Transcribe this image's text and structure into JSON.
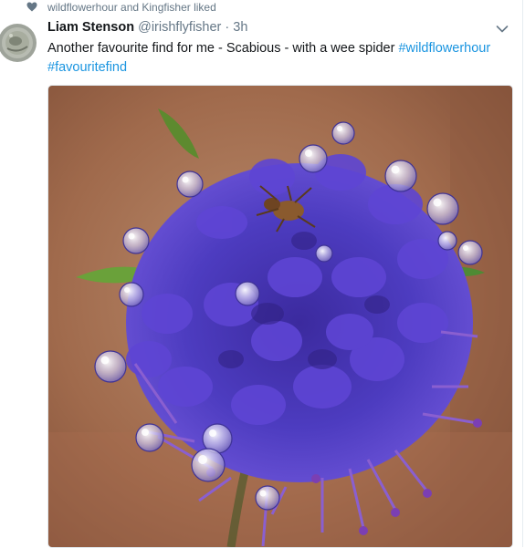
{
  "social_context": {
    "icon": "heart-icon",
    "text": "wildflowerhour and Kingfisher liked"
  },
  "tweet": {
    "author_name": "Liam Stenson",
    "author_handle": "@irishflyfisher",
    "separator": "·",
    "time": "3h",
    "text_main": "Another favourite find for me - Scabious - with a wee spider",
    "hashtags": [
      "#wildflowerhour",
      "#favouritefind"
    ],
    "media_subject": "Purple scabious flower head with water droplets and a small spider"
  },
  "colors": {
    "link": "#1b95e0",
    "muted": "#657786",
    "text": "#14171a",
    "flower": "#5b3fc4"
  }
}
